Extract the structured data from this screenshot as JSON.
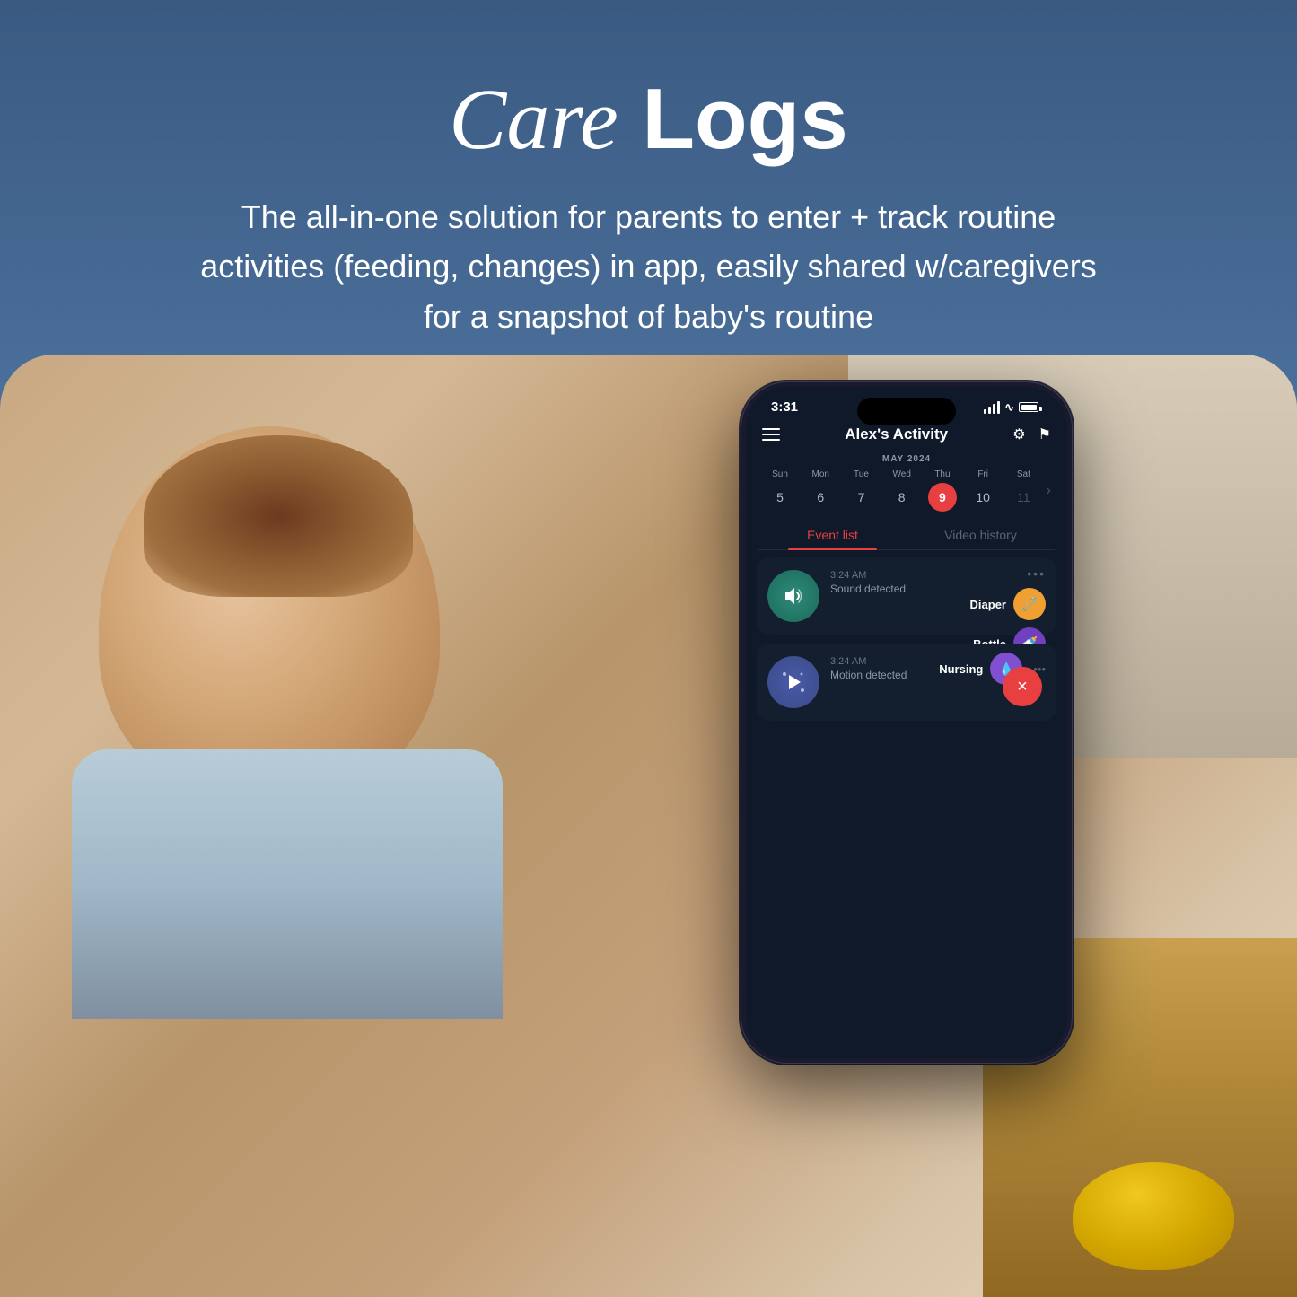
{
  "page": {
    "background": "gradient-blue"
  },
  "header": {
    "title_italic": "Care",
    "title_bold": " Logs",
    "subtitle": "The all-in-one solution for parents to enter + track routine activities (feeding, changes) in app, easily shared w/caregivers for a snapshot of baby's routine"
  },
  "phone": {
    "status_bar": {
      "time": "3:31",
      "signal": "signal",
      "wifi": "wifi",
      "battery": "battery"
    },
    "app_title": "Alex's Activity",
    "calendar": {
      "month_label": "MAY 2024",
      "days": [
        {
          "name": "Sun",
          "num": "5",
          "active": false,
          "muted": false
        },
        {
          "name": "Mon",
          "num": "6",
          "active": false,
          "muted": false
        },
        {
          "name": "Tue",
          "num": "7",
          "active": false,
          "muted": false
        },
        {
          "name": "Wed",
          "num": "8",
          "active": false,
          "muted": false
        },
        {
          "name": "Thu",
          "num": "9",
          "active": true,
          "muted": false
        },
        {
          "name": "Fri",
          "num": "10",
          "active": false,
          "muted": false
        },
        {
          "name": "Sat",
          "num": "11",
          "active": false,
          "muted": true
        }
      ]
    },
    "tabs": [
      {
        "label": "Event list",
        "active": true
      },
      {
        "label": "Video history",
        "active": false
      }
    ],
    "events": [
      {
        "id": "event1",
        "icon_type": "teal",
        "icon_symbol": "sound",
        "time": "3:24 AM",
        "description": "Sound detected",
        "badges": [
          {
            "label": "Diaper",
            "icon": "🧷",
            "color": "orange"
          },
          {
            "label": "Bottle",
            "icon": "🍼",
            "color": "purple"
          }
        ]
      },
      {
        "id": "event2",
        "icon_type": "blue-purple",
        "icon_symbol": "play",
        "time": "3:24 AM",
        "description": "Motion detected",
        "badges": [
          {
            "label": "Nursing",
            "icon": "💧",
            "color": "light-purple"
          }
        ]
      }
    ],
    "close_button_label": "×"
  },
  "icons": {
    "hamburger": "☰",
    "filter": "⚙",
    "flag": "⚑",
    "more": "•••",
    "chevron_right": "›"
  }
}
